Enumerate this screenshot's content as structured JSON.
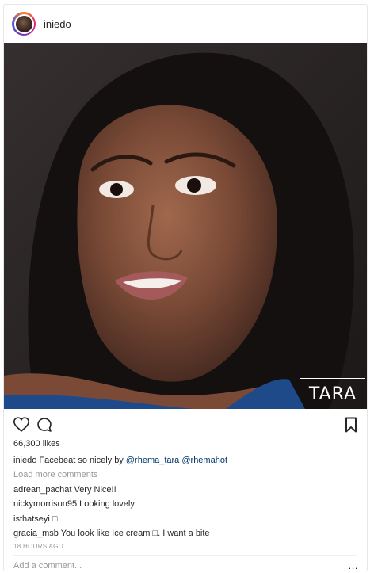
{
  "post": {
    "username": "iniedo",
    "watermark": "TARA",
    "likes": "66,300 likes",
    "caption": {
      "user": "iniedo",
      "text_before": " Facebeat so nicely by ",
      "mention_1": "@rhema_tara",
      "space": " ",
      "mention_2": "@rhemahot"
    },
    "load_more": "Load more comments",
    "comments": [
      {
        "user": "adrean_pachat",
        "text": " Very Nice!!"
      },
      {
        "user": "nickymorrison95",
        "text": " Looking lovely"
      },
      {
        "user": "isthatseyi",
        "text": " □"
      },
      {
        "user": "gracia_msb",
        "text": " You look like Ice cream □. I want a bite"
      }
    ],
    "timestamp": "18 HOURS AGO",
    "add_comment_placeholder": "Add a comment...",
    "more_options": "…"
  },
  "icons": {
    "like": "heart-icon",
    "comment": "speech-bubble-icon",
    "save": "bookmark-icon"
  }
}
